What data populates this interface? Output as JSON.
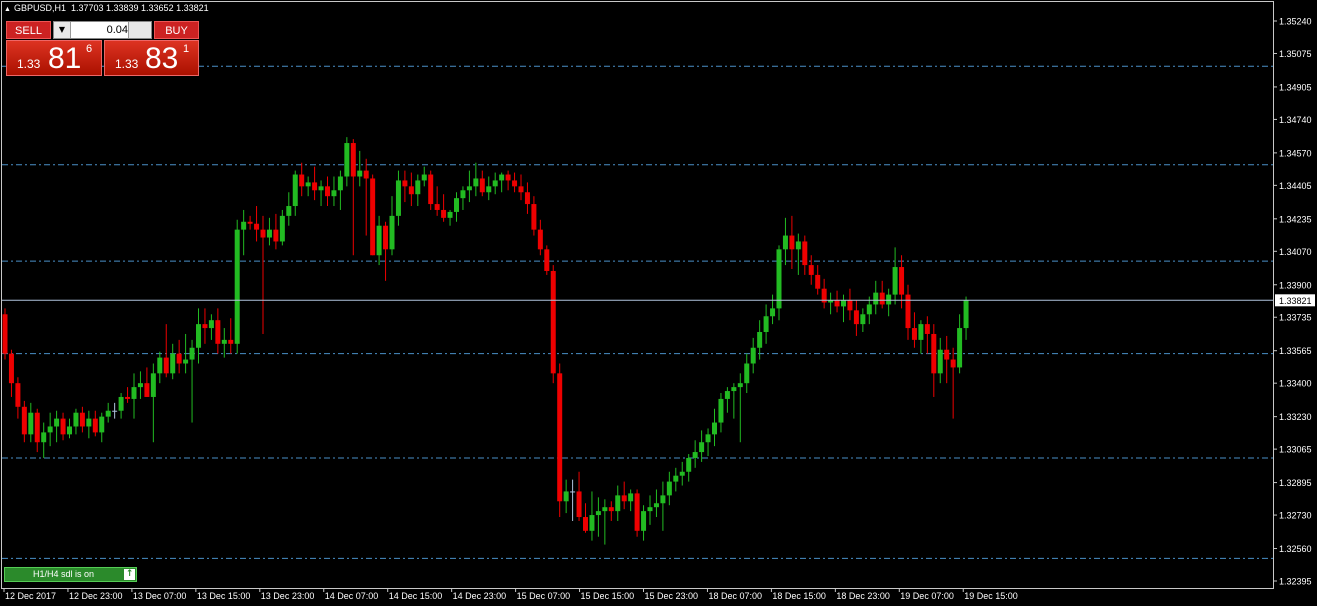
{
  "header": {
    "symbol": "GBPUSD,H1",
    "ohlc": "1.37703 1.33839 1.33652 1.33821"
  },
  "trade_panel": {
    "sell_label": "SELL",
    "buy_label": "BUY",
    "lot_value": "0.04",
    "sell_price": {
      "prefix": "1.33",
      "big": "81",
      "sup": "6"
    },
    "buy_price": {
      "prefix": "1.33",
      "big": "83",
      "sup": "1"
    }
  },
  "sdl_indicator": {
    "label": "H1/H4 sdl is on",
    "button_icon": "arrow-up-icon"
  },
  "colors": {
    "background": "#000000",
    "bull": "#22bb22",
    "bear": "#ee0000",
    "doji": "#b0c4de",
    "level_line": "#4a90c8",
    "current_price_line": "#b0c4de",
    "current_price_box": "#ffffff"
  },
  "chart_data": {
    "type": "candlestick",
    "symbol": "GBPUSD",
    "timeframe": "H1",
    "ylim": [
      1.32395,
      1.3531
    ],
    "y_ticks": [
      "1.35240",
      "1.35075",
      "1.34905",
      "1.34740",
      "1.34570",
      "1.34405",
      "1.34235",
      "1.34070",
      "1.33900",
      "1.33735",
      "1.33565",
      "1.33400",
      "1.33230",
      "1.33065",
      "1.32895",
      "1.32730",
      "1.32560",
      "1.32395"
    ],
    "current_price": "1.33821",
    "x_ticks": [
      "12 Dec 2017",
      "12 Dec 23:00",
      "13 Dec 07:00",
      "13 Dec 15:00",
      "13 Dec 23:00",
      "14 Dec 07:00",
      "14 Dec 15:00",
      "14 Dec 23:00",
      "15 Dec 07:00",
      "15 Dec 15:00",
      "15 Dec 23:00",
      "18 Dec 07:00",
      "18 Dec 15:00",
      "18 Dec 23:00",
      "19 Dec 07:00",
      "19 Dec 15:00"
    ],
    "levels": [
      1.3501,
      1.3451,
      1.3402,
      1.3355,
      1.3302,
      1.3251
    ],
    "candles": [
      [
        1.3375,
        1.3378,
        1.3352,
        1.3355
      ],
      [
        1.3355,
        1.3357,
        1.3333,
        1.334
      ],
      [
        1.334,
        1.3343,
        1.3322,
        1.3328
      ],
      [
        1.3328,
        1.3331,
        1.331,
        1.3314
      ],
      [
        1.3314,
        1.333,
        1.331,
        1.3325
      ],
      [
        1.3325,
        1.3327,
        1.3305,
        1.331
      ],
      [
        1.331,
        1.332,
        1.3302,
        1.3315
      ],
      [
        1.3315,
        1.3325,
        1.3308,
        1.3318
      ],
      [
        1.3318,
        1.3326,
        1.331,
        1.3322
      ],
      [
        1.3322,
        1.3325,
        1.3311,
        1.3314
      ],
      [
        1.3314,
        1.3322,
        1.3312,
        1.3318
      ],
      [
        1.3318,
        1.3327,
        1.3314,
        1.3325
      ],
      [
        1.3325,
        1.3328,
        1.3315,
        1.3318
      ],
      [
        1.3318,
        1.3326,
        1.3312,
        1.3322
      ],
      [
        1.3322,
        1.3326,
        1.3313,
        1.3315
      ],
      [
        1.3315,
        1.3325,
        1.331,
        1.3323
      ],
      [
        1.3323,
        1.333,
        1.332,
        1.3326
      ],
      [
        1.3326,
        1.333,
        1.3322,
        1.3326
      ],
      [
        1.3326,
        1.3335,
        1.3322,
        1.3333
      ],
      [
        1.3333,
        1.3338,
        1.333,
        1.3332
      ],
      [
        1.3332,
        1.3345,
        1.3322,
        1.3338
      ],
      [
        1.3338,
        1.3346,
        1.3332,
        1.334
      ],
      [
        1.334,
        1.3348,
        1.3333,
        1.3333
      ],
      [
        1.3333,
        1.335,
        1.331,
        1.3345
      ],
      [
        1.3345,
        1.3356,
        1.334,
        1.3353
      ],
      [
        1.3353,
        1.337,
        1.3343,
        1.3345
      ],
      [
        1.3345,
        1.336,
        1.3342,
        1.3355
      ],
      [
        1.3355,
        1.3362,
        1.3345,
        1.335
      ],
      [
        1.335,
        1.3365,
        1.3345,
        1.3352
      ],
      [
        1.3352,
        1.3362,
        1.332,
        1.3358
      ],
      [
        1.3358,
        1.3378,
        1.335,
        1.337
      ],
      [
        1.337,
        1.3378,
        1.336,
        1.3368
      ],
      [
        1.3368,
        1.3375,
        1.3362,
        1.3372
      ],
      [
        1.3372,
        1.3378,
        1.3355,
        1.336
      ],
      [
        1.336,
        1.3368,
        1.3353,
        1.3362
      ],
      [
        1.3362,
        1.3373,
        1.3355,
        1.336
      ],
      [
        1.336,
        1.3423,
        1.3355,
        1.3418
      ],
      [
        1.3418,
        1.3428,
        1.3405,
        1.3422
      ],
      [
        1.3422,
        1.3425,
        1.3418,
        1.3421
      ],
      [
        1.3421,
        1.343,
        1.3412,
        1.3418
      ],
      [
        1.3418,
        1.3425,
        1.3365,
        1.3414
      ],
      [
        1.3414,
        1.3424,
        1.341,
        1.3418
      ],
      [
        1.3418,
        1.3426,
        1.3408,
        1.3412
      ],
      [
        1.3412,
        1.3428,
        1.341,
        1.3425
      ],
      [
        1.3425,
        1.3437,
        1.342,
        1.343
      ],
      [
        1.343,
        1.3448,
        1.3425,
        1.3446
      ],
      [
        1.3446,
        1.3452,
        1.3435,
        1.344
      ],
      [
        1.344,
        1.3445,
        1.3435,
        1.3442
      ],
      [
        1.3442,
        1.345,
        1.3433,
        1.3438
      ],
      [
        1.3438,
        1.3443,
        1.343,
        1.344
      ],
      [
        1.344,
        1.3445,
        1.343,
        1.3435
      ],
      [
        1.3435,
        1.3445,
        1.343,
        1.3438
      ],
      [
        1.3438,
        1.3448,
        1.3428,
        1.3445
      ],
      [
        1.3445,
        1.3465,
        1.344,
        1.3462
      ],
      [
        1.3462,
        1.3464,
        1.3405,
        1.3445
      ],
      [
        1.3445,
        1.3458,
        1.344,
        1.3448
      ],
      [
        1.3448,
        1.3454,
        1.3415,
        1.3444
      ],
      [
        1.3444,
        1.3446,
        1.3405,
        1.3405
      ],
      [
        1.3405,
        1.3425,
        1.34,
        1.342
      ],
      [
        1.342,
        1.3422,
        1.3392,
        1.3408
      ],
      [
        1.3408,
        1.3435,
        1.3405,
        1.3425
      ],
      [
        1.3425,
        1.3448,
        1.342,
        1.3443
      ],
      [
        1.3443,
        1.3448,
        1.3432,
        1.344
      ],
      [
        1.344,
        1.3447,
        1.343,
        1.3436
      ],
      [
        1.3436,
        1.3446,
        1.343,
        1.3443
      ],
      [
        1.3443,
        1.345,
        1.344,
        1.3446
      ],
      [
        1.3446,
        1.3448,
        1.3428,
        1.3431
      ],
      [
        1.3431,
        1.344,
        1.3425,
        1.3428
      ],
      [
        1.3428,
        1.3436,
        1.3422,
        1.3424
      ],
      [
        1.3424,
        1.3428,
        1.342,
        1.3427
      ],
      [
        1.3427,
        1.3437,
        1.3422,
        1.3434
      ],
      [
        1.3434,
        1.344,
        1.3428,
        1.3438
      ],
      [
        1.3438,
        1.3448,
        1.3432,
        1.344
      ],
      [
        1.344,
        1.3452,
        1.3435,
        1.3444
      ],
      [
        1.3444,
        1.3448,
        1.3435,
        1.3437
      ],
      [
        1.3437,
        1.3445,
        1.3433,
        1.344
      ],
      [
        1.344,
        1.3447,
        1.3436,
        1.3443
      ],
      [
        1.3443,
        1.3447,
        1.3437,
        1.3446
      ],
      [
        1.3446,
        1.3448,
        1.3438,
        1.3443
      ],
      [
        1.3443,
        1.3447,
        1.3437,
        1.344
      ],
      [
        1.344,
        1.3446,
        1.3433,
        1.3437
      ],
      [
        1.3437,
        1.3442,
        1.3426,
        1.3431
      ],
      [
        1.3431,
        1.3435,
        1.3415,
        1.3418
      ],
      [
        1.3418,
        1.3423,
        1.3405,
        1.3408
      ],
      [
        1.3408,
        1.341,
        1.3395,
        1.3397
      ],
      [
        1.3397,
        1.34,
        1.334,
        1.3345
      ],
      [
        1.3345,
        1.335,
        1.3272,
        1.328
      ],
      [
        1.328,
        1.3291,
        1.3274,
        1.3285
      ],
      [
        1.3285,
        1.3291,
        1.327,
        1.3285
      ],
      [
        1.3285,
        1.3295,
        1.327,
        1.3272
      ],
      [
        1.3272,
        1.3279,
        1.3264,
        1.3265
      ],
      [
        1.3265,
        1.3285,
        1.326,
        1.3273
      ],
      [
        1.3273,
        1.3282,
        1.3262,
        1.3275
      ],
      [
        1.3275,
        1.3281,
        1.3258,
        1.3277
      ],
      [
        1.3277,
        1.328,
        1.327,
        1.3275
      ],
      [
        1.3275,
        1.3288,
        1.327,
        1.3283
      ],
      [
        1.3283,
        1.329,
        1.3276,
        1.328
      ],
      [
        1.328,
        1.3286,
        1.3275,
        1.3284
      ],
      [
        1.3284,
        1.3286,
        1.3262,
        1.3265
      ],
      [
        1.3265,
        1.3278,
        1.326,
        1.3275
      ],
      [
        1.3275,
        1.3283,
        1.3268,
        1.3277
      ],
      [
        1.3277,
        1.3286,
        1.3272,
        1.3279
      ],
      [
        1.3279,
        1.329,
        1.3265,
        1.3283
      ],
      [
        1.3283,
        1.3295,
        1.3278,
        1.329
      ],
      [
        1.329,
        1.3297,
        1.3285,
        1.3293
      ],
      [
        1.3293,
        1.33,
        1.3288,
        1.3295
      ],
      [
        1.3295,
        1.3304,
        1.329,
        1.3302
      ],
      [
        1.3302,
        1.3311,
        1.3297,
        1.3305
      ],
      [
        1.3305,
        1.3316,
        1.33,
        1.331
      ],
      [
        1.331,
        1.3317,
        1.3303,
        1.3314
      ],
      [
        1.3314,
        1.3327,
        1.3308,
        1.332
      ],
      [
        1.332,
        1.3335,
        1.3315,
        1.3332
      ],
      [
        1.3332,
        1.3338,
        1.3325,
        1.3336
      ],
      [
        1.3336,
        1.334,
        1.3322,
        1.3338
      ],
      [
        1.3338,
        1.3345,
        1.331,
        1.334
      ],
      [
        1.334,
        1.3355,
        1.3335,
        1.335
      ],
      [
        1.335,
        1.3363,
        1.3345,
        1.3358
      ],
      [
        1.3358,
        1.3372,
        1.3352,
        1.3366
      ],
      [
        1.3366,
        1.338,
        1.336,
        1.3374
      ],
      [
        1.3374,
        1.3385,
        1.337,
        1.3378
      ],
      [
        1.3378,
        1.341,
        1.3372,
        1.3408
      ],
      [
        1.3408,
        1.3424,
        1.34,
        1.3415
      ],
      [
        1.3415,
        1.3425,
        1.3398,
        1.3408
      ],
      [
        1.3408,
        1.3416,
        1.3395,
        1.3412
      ],
      [
        1.3412,
        1.3415,
        1.3395,
        1.34
      ],
      [
        1.34,
        1.3405,
        1.339,
        1.3395
      ],
      [
        1.3395,
        1.34,
        1.3385,
        1.3388
      ],
      [
        1.3388,
        1.3393,
        1.3378,
        1.3381
      ],
      [
        1.3381,
        1.3386,
        1.3375,
        1.3382
      ],
      [
        1.3382,
        1.3387,
        1.3376,
        1.3379
      ],
      [
        1.3379,
        1.3385,
        1.3371,
        1.3382
      ],
      [
        1.3382,
        1.3388,
        1.3372,
        1.3377
      ],
      [
        1.3377,
        1.3382,
        1.3364,
        1.337
      ],
      [
        1.337,
        1.3378,
        1.3366,
        1.3375
      ],
      [
        1.3375,
        1.3384,
        1.337,
        1.338
      ],
      [
        1.338,
        1.3392,
        1.3375,
        1.3386
      ],
      [
        1.3386,
        1.3392,
        1.3378,
        1.338
      ],
      [
        1.338,
        1.3388,
        1.3374,
        1.3385
      ],
      [
        1.3385,
        1.3409,
        1.338,
        1.3399
      ],
      [
        1.3399,
        1.3405,
        1.3378,
        1.3385
      ],
      [
        1.3385,
        1.339,
        1.3362,
        1.3368
      ],
      [
        1.3368,
        1.3376,
        1.3358,
        1.3362
      ],
      [
        1.3362,
        1.3372,
        1.3355,
        1.337
      ],
      [
        1.337,
        1.3374,
        1.3355,
        1.3365
      ],
      [
        1.3365,
        1.337,
        1.3333,
        1.3345
      ],
      [
        1.3345,
        1.3363,
        1.334,
        1.3357
      ],
      [
        1.3357,
        1.3364,
        1.334,
        1.3352
      ],
      [
        1.3352,
        1.3358,
        1.3322,
        1.3348
      ],
      [
        1.3348,
        1.3375,
        1.3345,
        1.3368
      ],
      [
        1.3368,
        1.3384,
        1.3362,
        1.3382
      ]
    ]
  }
}
